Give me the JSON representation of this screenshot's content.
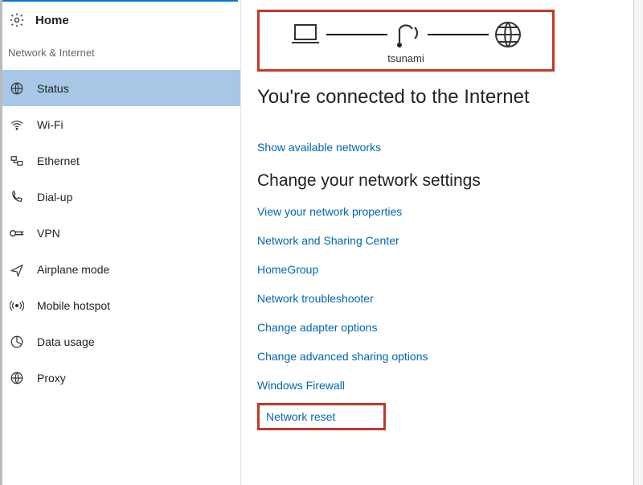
{
  "sidebar": {
    "home_label": "Home",
    "section_label": "Network & Internet",
    "items": [
      {
        "label": "Status",
        "icon": "status-icon",
        "active": true
      },
      {
        "label": "Wi-Fi",
        "icon": "wifi-icon",
        "active": false
      },
      {
        "label": "Ethernet",
        "icon": "ethernet-icon",
        "active": false
      },
      {
        "label": "Dial-up",
        "icon": "dialup-icon",
        "active": false
      },
      {
        "label": "VPN",
        "icon": "vpn-icon",
        "active": false
      },
      {
        "label": "Airplane mode",
        "icon": "airplane-icon",
        "active": false
      },
      {
        "label": "Mobile hotspot",
        "icon": "hotspot-icon",
        "active": false
      },
      {
        "label": "Data usage",
        "icon": "datausage-icon",
        "active": false
      },
      {
        "label": "Proxy",
        "icon": "proxy-icon",
        "active": false
      }
    ]
  },
  "main": {
    "diagram_network_name": "tsunami",
    "connected_heading": "You're connected to the Internet",
    "show_networks_link": "Show available networks",
    "change_settings_heading": "Change your network settings",
    "links": [
      "View your network properties",
      "Network and Sharing Center",
      "HomeGroup",
      "Network troubleshooter",
      "Change adapter options",
      "Change advanced sharing options",
      "Windows Firewall"
    ],
    "network_reset_link": "Network reset"
  },
  "colors": {
    "accent": "#0078d7",
    "link": "#0066b3",
    "highlight_box": "#c0392b",
    "sidebar_active": "#a6c8e4"
  }
}
